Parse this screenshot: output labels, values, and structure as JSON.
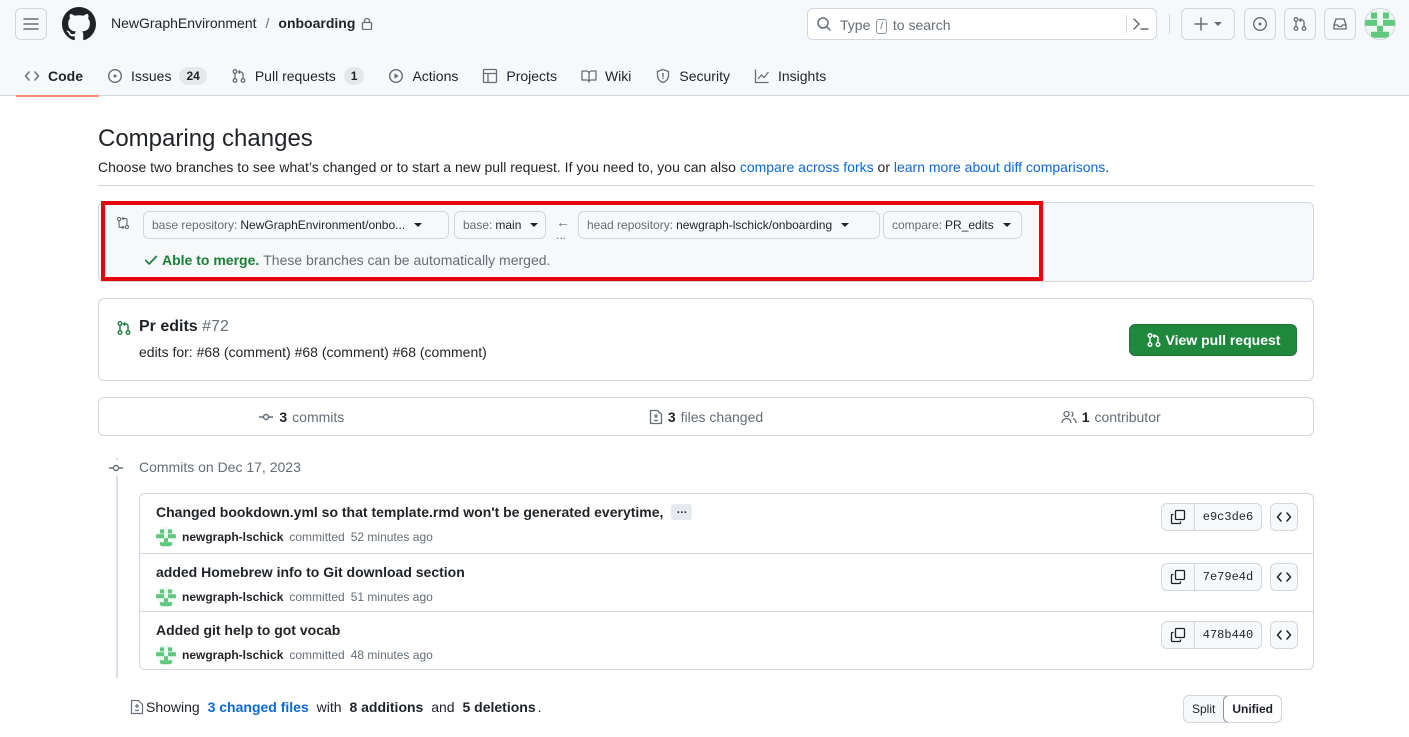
{
  "header": {
    "owner": "NewGraphEnvironment",
    "separator": "/",
    "repo": "onboarding",
    "search_placeholder_prefix": "Type",
    "search_key": "/",
    "search_placeholder_suffix": "to search"
  },
  "tabs": [
    {
      "label": "Code",
      "icon": "code-icon",
      "active": true
    },
    {
      "label": "Issues",
      "icon": "issue-icon",
      "count": "24"
    },
    {
      "label": "Pull requests",
      "icon": "pull-request-icon",
      "count": "1"
    },
    {
      "label": "Actions",
      "icon": "play-icon"
    },
    {
      "label": "Projects",
      "icon": "table-icon"
    },
    {
      "label": "Wiki",
      "icon": "book-icon"
    },
    {
      "label": "Security",
      "icon": "shield-icon"
    },
    {
      "label": "Insights",
      "icon": "graph-icon"
    }
  ],
  "page": {
    "title": "Comparing changes",
    "subtitle_text": "Choose two branches to see what’s changed or to start a new pull request. If you need to, you can also ",
    "link_forks": "compare across forks",
    "subtitle_or": " or ",
    "link_learn": "learn more about diff comparisons",
    "subtitle_end": "."
  },
  "range": {
    "base_repo_label": "base repository:",
    "base_repo_value": "NewGraphEnvironment/onbo...",
    "base_label": "base:",
    "base_value": "main",
    "arrow": "←",
    "dots": "...",
    "head_repo_label": "head repository:",
    "head_repo_value": "newgraph-lschick/onboarding",
    "compare_label": "compare:",
    "compare_value": "PR_edits",
    "merge_ok": "Able to merge.",
    "merge_rest": "These branches can be automatically merged."
  },
  "pull_request": {
    "title": "Pr edits",
    "number": "#72",
    "description": "edits for: #68 (comment) #68 (comment) #68 (comment)",
    "button": "View pull request"
  },
  "stats": {
    "commits_count": "3",
    "commits_label": "commits",
    "files_count": "3",
    "files_label": "files changed",
    "contributors_count": "1",
    "contributors_label": "contributor"
  },
  "commits_date": "Commits on Dec 17, 2023",
  "commits": [
    {
      "message": "Changed bookdown.yml so that template.rmd won't be generated everytime,",
      "ellipsis": "…",
      "author": "newgraph-lschick",
      "action": "committed",
      "time": "52 minutes ago",
      "sha": "e9c3de6"
    },
    {
      "message": "added Homebrew info to Git download section",
      "author": "newgraph-lschick",
      "action": "committed",
      "time": "51 minutes ago",
      "sha": "7e79e4d"
    },
    {
      "message": "Added git help to got vocab",
      "author": "newgraph-lschick",
      "action": "committed",
      "time": "48 minutes ago",
      "sha": "478b440"
    }
  ],
  "summary": {
    "showing": "Showing",
    "changed_files": "3 changed files",
    "with": "with",
    "additions": "8 additions",
    "and": "and",
    "deletions": "5 deletions",
    "end": "."
  },
  "view_toggle": {
    "split": "Split",
    "unified": "Unified",
    "selected": "Unified"
  },
  "colors": {
    "accent": "#0969da",
    "success": "#1a7f37",
    "button_green": "#1f883d",
    "highlight_red": "#e8000b",
    "tab_underline": "#fd8c73"
  }
}
